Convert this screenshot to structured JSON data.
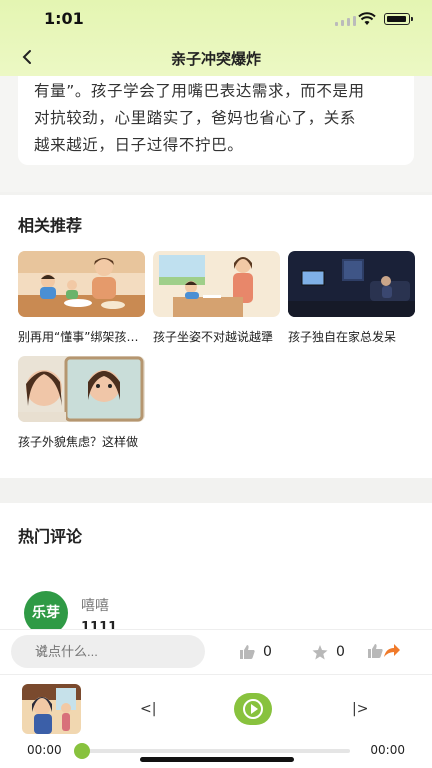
{
  "status_bar": {
    "time": "1:01"
  },
  "nav": {
    "title": "亲子冲突爆炸"
  },
  "article": {
    "lines": [
      "有量”。孩子学会了用嘴巴表达需求，而不是用",
      "对抗较劲，心里踏实了，爸妈也省心了，关系",
      "越来越近，日子过得不拧巴。"
    ]
  },
  "related": {
    "title": "相关推荐",
    "items": [
      {
        "caption": "别再用“懂事”绑架孩子了"
      },
      {
        "caption": "孩子坐姿不对越说越犟"
      },
      {
        "caption": "孩子独自在家总发呆"
      },
      {
        "caption": "孩子外貌焦虑？这样做"
      }
    ]
  },
  "comments": {
    "title": "热门评论",
    "items": [
      {
        "avatar_text": "乐芽",
        "user": "嘻嘻",
        "text": "1111"
      }
    ]
  },
  "comment_bar": {
    "placeholder": "说点什么...",
    "like_count": "0",
    "fav_count": "0"
  },
  "player": {
    "prev_label": "<|",
    "next_label": "|>",
    "current_time": "00:00",
    "total_time": "00:00",
    "progress": 0
  },
  "colors": {
    "accent": "#88c23e",
    "header": "#e6f6b6",
    "share": "#f07a2a"
  }
}
